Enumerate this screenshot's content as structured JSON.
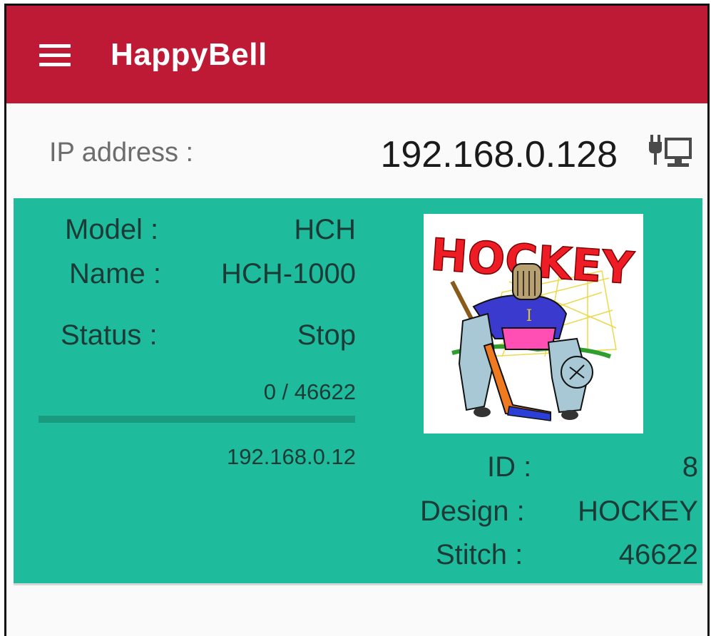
{
  "app_bar": {
    "title": "HappyBell",
    "menu_icon": "hamburger-menu-icon",
    "background": "#be1a36"
  },
  "connection": {
    "ip_label": "IP address :",
    "ip_value": "192.168.0.128",
    "status_icon": "wired-network-icon"
  },
  "machine": {
    "background": "#1ebc9d",
    "model_label": "Model :",
    "model_value": "HCH",
    "name_label": "Name :",
    "name_value": "HCH-1000",
    "status_label": "Status :",
    "status_value": "Stop",
    "progress_text": "0 / 46622",
    "progress_fraction": 0,
    "machine_ip": "192.168.0.12",
    "design_image": {
      "title_text": "HOCKEY",
      "badge_letter": "I"
    },
    "id_label": "ID :",
    "id_value": "8",
    "design_label": "Design :",
    "design_value": "HOCKEY",
    "stitch_label": "Stitch :",
    "stitch_value": "46622"
  }
}
